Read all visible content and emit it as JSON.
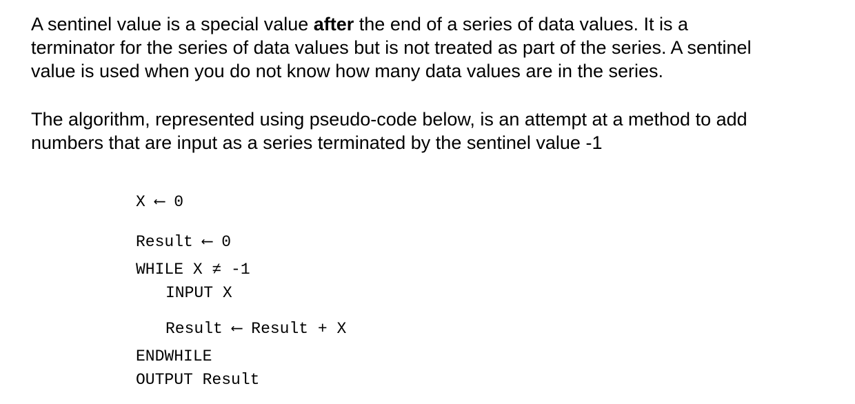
{
  "paragraph1": {
    "line1_before": "A sentinel value is a special value ",
    "line1_bold": "after",
    "line1_after": " the end of a series of data values. It is a",
    "line2": "terminator for the series of data values but is not treated as part of the series. A sentinel",
    "line3": "value is used when you do not know how many data values are in the series."
  },
  "paragraph2": {
    "line1": "The algorithm, represented using pseudo-code below, is an attempt at a method to add",
    "line2": "numbers that are input as a series terminated by the sentinel value -1"
  },
  "pseudocode": [
    "X ⟵ 0",
    "Result ⟵ 0",
    "WHILE X ≠ -1",
    "INPUT X",
    "Result ⟵ Result + X",
    "ENDWHILE",
    "OUTPUT Result"
  ]
}
